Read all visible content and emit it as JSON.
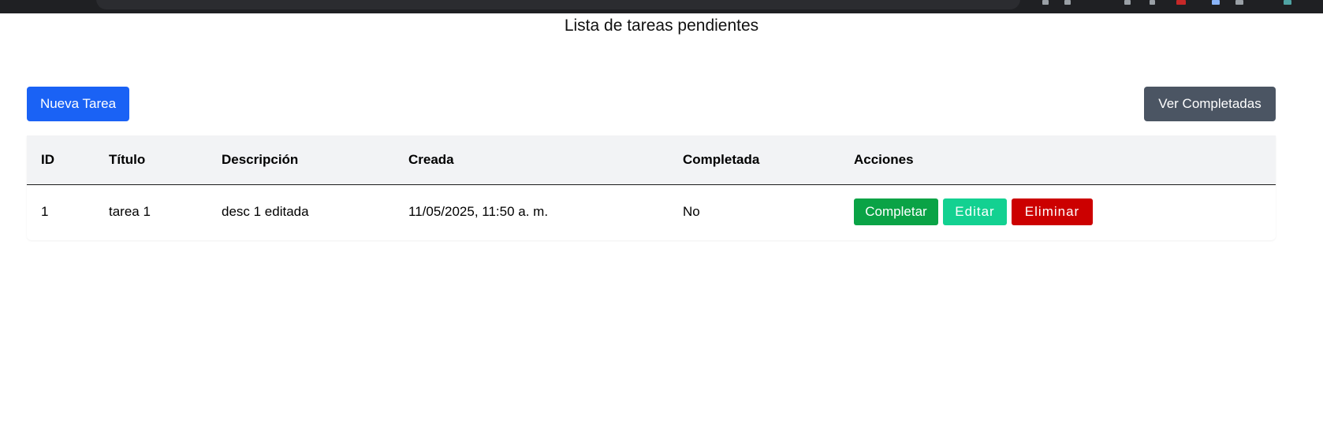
{
  "page": {
    "title": "Lista de tareas pendientes"
  },
  "toolbar": {
    "new_task_label": "Nueva Tarea",
    "view_completed_label": "Ver Completadas"
  },
  "table": {
    "headers": [
      "ID",
      "Título",
      "Descripción",
      "Creada",
      "Completada",
      "Acciones"
    ],
    "rows": [
      {
        "id": "1",
        "title": "tarea 1",
        "description": "desc 1 editada",
        "created": "11/05/2025, 11:50 a. m.",
        "completed": "No",
        "actions": {
          "complete_label": "Completar",
          "edit_label": "Editar",
          "delete_label": "Eliminar"
        }
      }
    ]
  },
  "colors": {
    "primary": "#1a62f5",
    "secondary": "#4b5563",
    "success": "#0aa346",
    "edit": "#13d191",
    "danger": "#cc0000",
    "header_bg": "#f2f3f5"
  }
}
